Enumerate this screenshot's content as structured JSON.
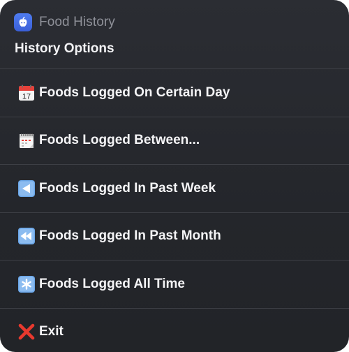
{
  "app": {
    "name": "Food History",
    "icon": "apple-icon",
    "accent": "#4a74ea"
  },
  "menu": {
    "title": "History Options",
    "items": [
      {
        "label": "Foods Logged On Certain Day",
        "icon": "calendar-17-icon"
      },
      {
        "label": "Foods Logged Between...",
        "icon": "spiral-calendar-icon"
      },
      {
        "label": "Foods Logged In Past Week",
        "icon": "reverse-button-icon"
      },
      {
        "label": "Foods Logged In Past Month",
        "icon": "fast-reverse-button-icon"
      },
      {
        "label": "Foods Logged All Time",
        "icon": "asterisk-icon"
      },
      {
        "label": "Exit",
        "icon": "cross-mark-icon"
      }
    ],
    "calendar_day": "17"
  },
  "colors": {
    "background": "#26282d",
    "divider": "#3d3f45",
    "exit_red": "#e8392e",
    "button_blue": "#6aa6e8"
  }
}
